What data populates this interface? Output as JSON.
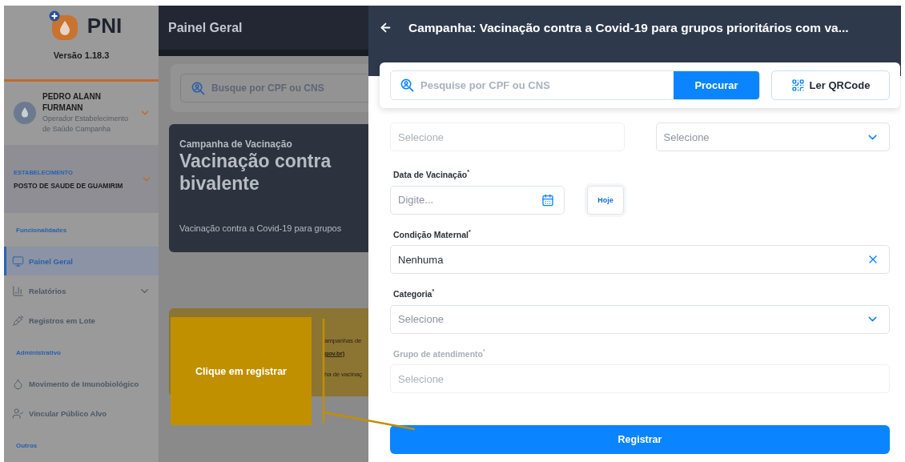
{
  "sidebar": {
    "app_name": "PNI",
    "version": "Versão 1.18.3",
    "user": {
      "name": "PEDRO ALANN FURMANN",
      "role": "Operador Estabelecimento de Saúde Campanha"
    },
    "establishment": {
      "label": "ESTABELECIMENTO",
      "value": "POSTO DE SAUDE DE GUAMIRIM"
    },
    "sections": [
      {
        "title": "Funcionalidades",
        "items": [
          {
            "label": "Painel Geral",
            "selected": true,
            "expandable": false
          },
          {
            "label": "Relatórios",
            "selected": false,
            "expandable": true
          },
          {
            "label": "Registros em Lote",
            "selected": false,
            "expandable": false
          }
        ]
      },
      {
        "title": "Administrativo",
        "items": [
          {
            "label": "Movimento de Imunobiológico",
            "selected": false,
            "expandable": false
          },
          {
            "label": "Vincular Público Alvo",
            "selected": false,
            "expandable": false
          }
        ]
      },
      {
        "title": "Outros"
      }
    ]
  },
  "dashboard": {
    "title": "Painel Geral",
    "search": {
      "placeholder": "Busque por CPF ou CNS"
    },
    "campaign_card": {
      "eyebrow": "Campanha de Vacinação",
      "title_lines": [
        "Vacinação contra",
        "bivalente"
      ],
      "description": "Vacinação contra a Covid-19 para grupos"
    },
    "notice_card": {
      "lines": [
        {
          "kind": "text",
          "text": "ampanhas de"
        },
        {
          "kind": "link",
          "text": "gov.br)"
        },
        {
          "kind": "text",
          "text": "ha de vacinaç"
        }
      ]
    }
  },
  "callout": {
    "text": "Clique em registrar"
  },
  "drawer": {
    "title": "Campanha: Vacinação contra a Covid-19 para grupos prioritários com va...",
    "search": {
      "placeholder": "Pesquise por CPF ou CNS",
      "button": "Procurar"
    },
    "qr_button": "Ler QRCode",
    "rows": [
      {
        "fields": [
          {
            "kind": "select",
            "placeholder": "Selecione",
            "disabled": true
          },
          {
            "kind": "select",
            "placeholder": "Selecione",
            "disabled": false
          }
        ]
      },
      {
        "fields": [
          {
            "kind": "date",
            "label": "Data de Vacinação$^{*}$",
            "placeholder": "Digite...",
            "disabled": false,
            "today_button": "Hoje"
          }
        ]
      },
      {
        "fields": [
          {
            "kind": "select",
            "label": "Condição Maternal$^{*}$",
            "value": "Nenhuma",
            "disabled": false
          }
        ]
      },
      {
        "fields": [
          {
            "kind": "select",
            "label": "Categoria$^{*}$",
            "placeholder": "Selecione",
            "disabled": false
          }
        ]
      },
      {
        "fields": [
          {
            "kind": "select",
            "label": "Grupo de atendimento$^{*}$",
            "placeholder": "Selecione",
            "disabled": true
          }
        ]
      }
    ],
    "submit": "Registrar"
  }
}
